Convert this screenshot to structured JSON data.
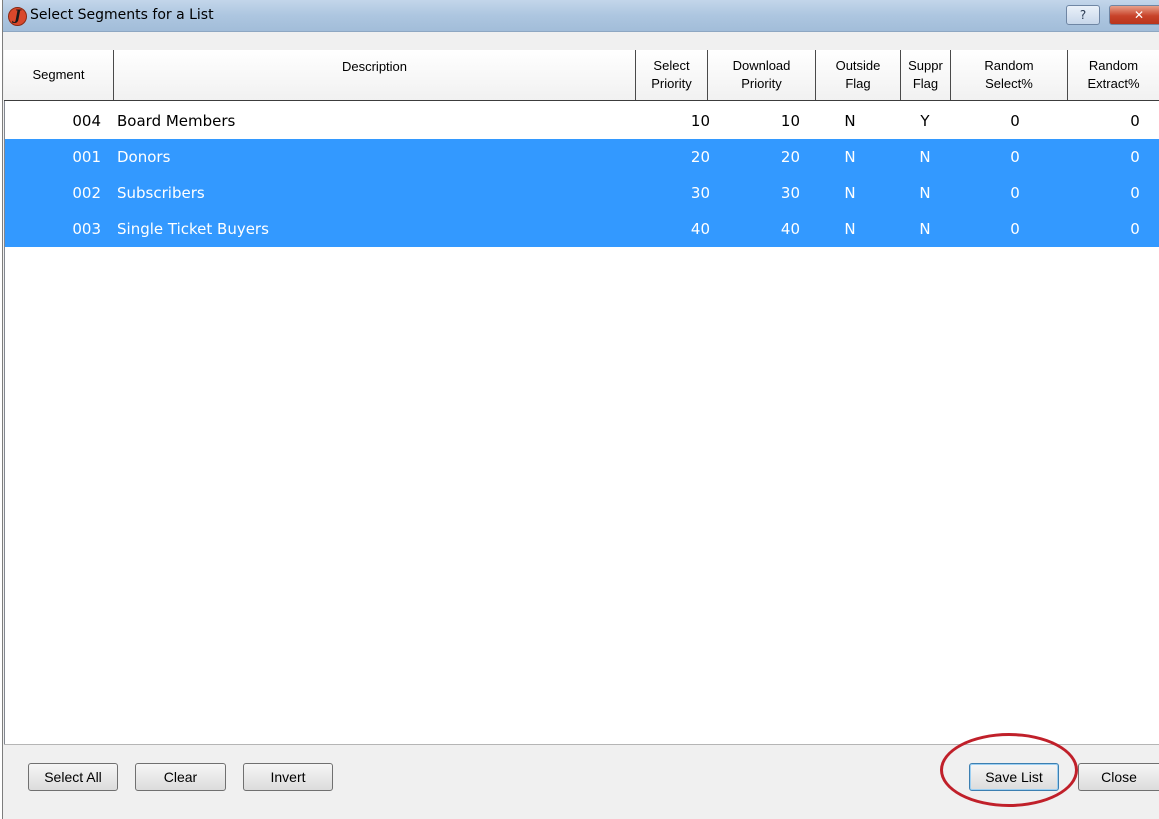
{
  "window": {
    "title": "Select Segments for a List",
    "app_icon_glyph": "J",
    "help_label": "?",
    "close_label": "✕"
  },
  "columns": [
    {
      "line1": "Segment",
      "line2": ""
    },
    {
      "line1": "Description",
      "line2": ""
    },
    {
      "line1": "Select",
      "line2": "Priority"
    },
    {
      "line1": "Download",
      "line2": "Priority"
    },
    {
      "line1": "Outside",
      "line2": "Flag"
    },
    {
      "line1": "Suppr",
      "line2": "Flag"
    },
    {
      "line1": "Random",
      "line2": "Select%"
    },
    {
      "line1": "Random",
      "line2": "Extract%"
    }
  ],
  "rows": [
    {
      "segment": "004",
      "description": "Board Members",
      "select_priority": "10",
      "download_priority": "10",
      "outside_flag": "N",
      "suppr_flag": "Y",
      "random_select": "0",
      "random_extract": "0",
      "selected": false
    },
    {
      "segment": "001",
      "description": "Donors",
      "select_priority": "20",
      "download_priority": "20",
      "outside_flag": "N",
      "suppr_flag": "N",
      "random_select": "0",
      "random_extract": "0",
      "selected": true
    },
    {
      "segment": "002",
      "description": "Subscribers",
      "select_priority": "30",
      "download_priority": "30",
      "outside_flag": "N",
      "suppr_flag": "N",
      "random_select": "0",
      "random_extract": "0",
      "selected": true
    },
    {
      "segment": "003",
      "description": "Single Ticket Buyers",
      "select_priority": "40",
      "download_priority": "40",
      "outside_flag": "N",
      "suppr_flag": "N",
      "random_select": "0",
      "random_extract": "0",
      "selected": true
    }
  ],
  "buttons": {
    "select_all": "Select All",
    "clear": "Clear",
    "invert": "Invert",
    "save_list": "Save List",
    "close": "Close"
  },
  "colors": {
    "selection": "#3399ff",
    "annotation_ring": "#c0202a"
  }
}
